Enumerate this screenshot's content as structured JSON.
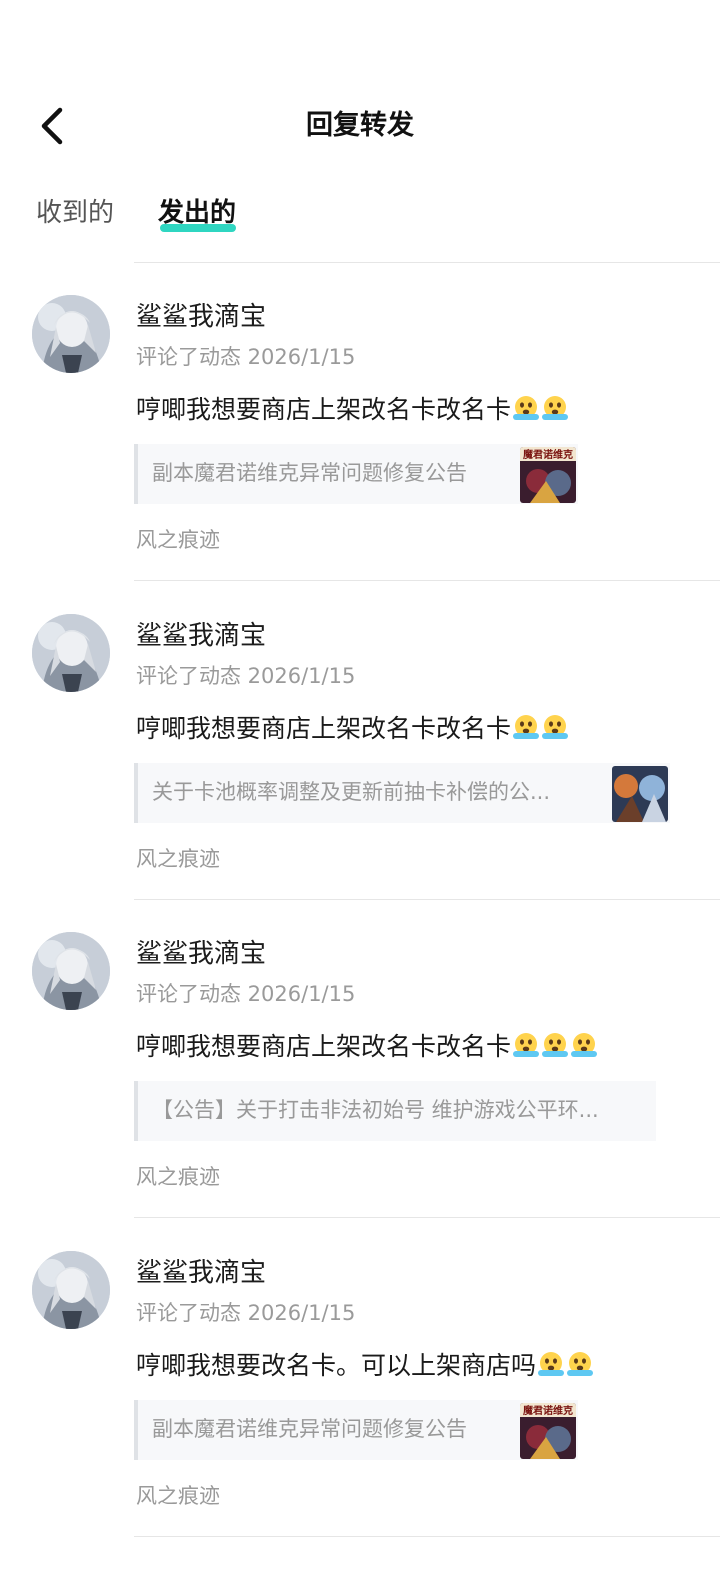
{
  "header": {
    "title": "回复转发",
    "back_icon": "chevron-left-icon"
  },
  "tabs": [
    {
      "label": "收到的",
      "active": false
    },
    {
      "label": "发出的",
      "active": true
    }
  ],
  "colors": {
    "accent": "#2fd6c1",
    "secondary_text": "#9a9a9a",
    "quote_bg": "#f7f8fa"
  },
  "items": [
    {
      "user": "鲨鲨我滴宝",
      "meta": "评论了动态 2026/1/15",
      "text": "哼唧我想要商店上架改名卡改名卡",
      "emoji_count": 2,
      "emoji_icon": "crying-face-icon",
      "quote": "副本魔君诺维克异常问题修复公告",
      "thumb_caption": "魔君诺维克",
      "source": "风之痕迹"
    },
    {
      "user": "鲨鲨我滴宝",
      "meta": "评论了动态 2026/1/15",
      "text": "哼唧我想要商店上架改名卡改名卡",
      "emoji_count": 2,
      "emoji_icon": "crying-face-icon",
      "quote": "关于卡池概率调整及更新前抽卡补偿的公...",
      "thumb_caption": "",
      "source": "风之痕迹"
    },
    {
      "user": "鲨鲨我滴宝",
      "meta": "评论了动态 2026/1/15",
      "text": "哼唧我想要商店上架改名卡改名卡",
      "emoji_count": 3,
      "emoji_icon": "crying-face-icon",
      "quote": "【公告】关于打击非法初始号 维护游戏公平环...",
      "thumb_caption": "",
      "source": "风之痕迹"
    },
    {
      "user": "鲨鲨我滴宝",
      "meta": "评论了动态 2026/1/15",
      "text": "哼唧我想要改名卡。可以上架商店吗",
      "emoji_count": 2,
      "emoji_icon": "crying-face-icon",
      "quote": "副本魔君诺维克异常问题修复公告",
      "thumb_caption": "魔君诺维克",
      "source": "风之痕迹"
    }
  ]
}
